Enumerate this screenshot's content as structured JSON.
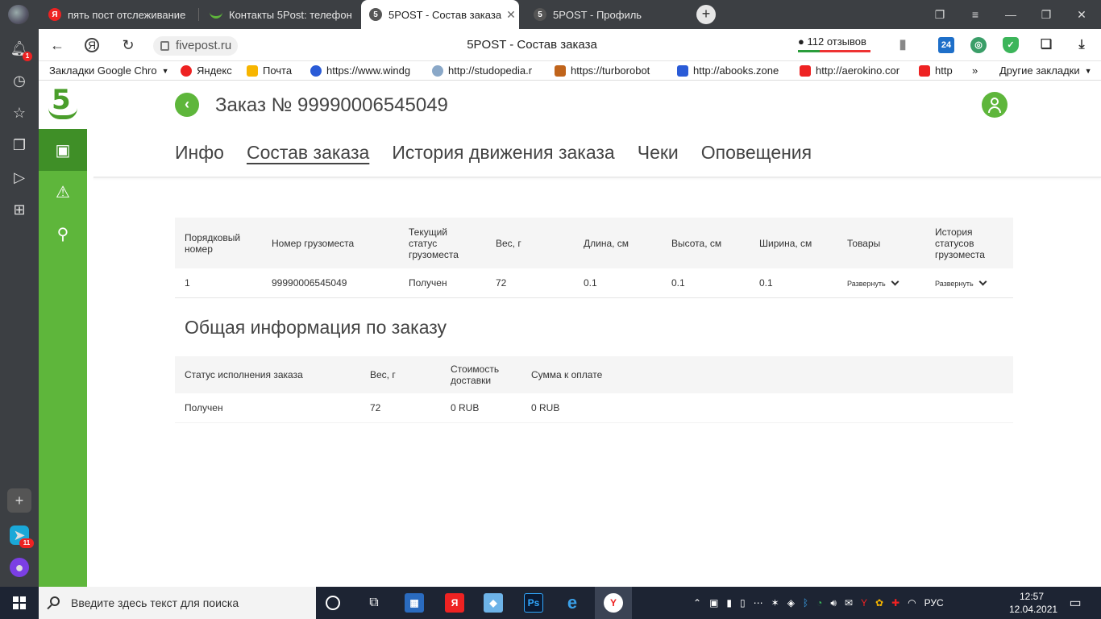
{
  "browser": {
    "tabs": [
      {
        "label": "пять пост отслеживание",
        "favicon": "yandex-icon"
      },
      {
        "label": "Контакты 5Post: телефон",
        "favicon": "5post-smile-icon"
      },
      {
        "label": "5POST - Состав заказа",
        "favicon": "5post-icon",
        "active": true
      },
      {
        "label": "5POST - Профиль",
        "favicon": "5post-icon"
      }
    ],
    "url": "fivepost.ru",
    "page_title": "5POST - Состав заказа",
    "reviews": "112 отзывов",
    "ext_24": "24",
    "bookmarks": [
      "Закладки Google Chro",
      "Яндекс",
      "Почта",
      "https://www.windg",
      "http://studopedia.r",
      "https://turborobot",
      "http://abooks.zone",
      "http://aerokino.cor",
      "http",
      "Другие закладки"
    ],
    "notif_badge": "1",
    "messenger_badge": "11"
  },
  "app": {
    "logo_digit": "5",
    "order_title": "Заказ № 99990006545049",
    "tabs": [
      "Инфо",
      "Состав заказа",
      "История движения заказа",
      "Чеки",
      "Оповещения"
    ],
    "active_tab": "Состав заказа",
    "shipments": {
      "headers": [
        "Порядковый номер",
        "Номер грузоместа",
        "Текущий статус грузоместа",
        "Вес, г",
        "Длина, см",
        "Высота, см",
        "Ширина, см",
        "Товары",
        "История статусов грузоместа"
      ],
      "rows": [
        {
          "index": "1",
          "number": "99990006545049",
          "status": "Получен",
          "weight": "72",
          "length": "0.1",
          "height": "0.1",
          "width": "0.1",
          "goods": "Развернуть",
          "history": "Развернуть"
        }
      ]
    },
    "summary_title": "Общая информация по заказу",
    "summary": {
      "headers": [
        "Статус исполнения заказа",
        "Вес, г",
        "Стоимость доставки",
        "Сумма к оплате"
      ],
      "row": {
        "status": "Получен",
        "weight": "72",
        "delivery_cost": "0 RUB",
        "amount_due": "0 RUB"
      }
    },
    "colors": {
      "brand_green": "#5eb63b",
      "brand_green_dark": "#3f8f27"
    }
  },
  "taskbar": {
    "search_placeholder": "Введите здесь текст для поиска",
    "lang": "РУС",
    "time": "12:57",
    "date": "12.04.2021"
  }
}
